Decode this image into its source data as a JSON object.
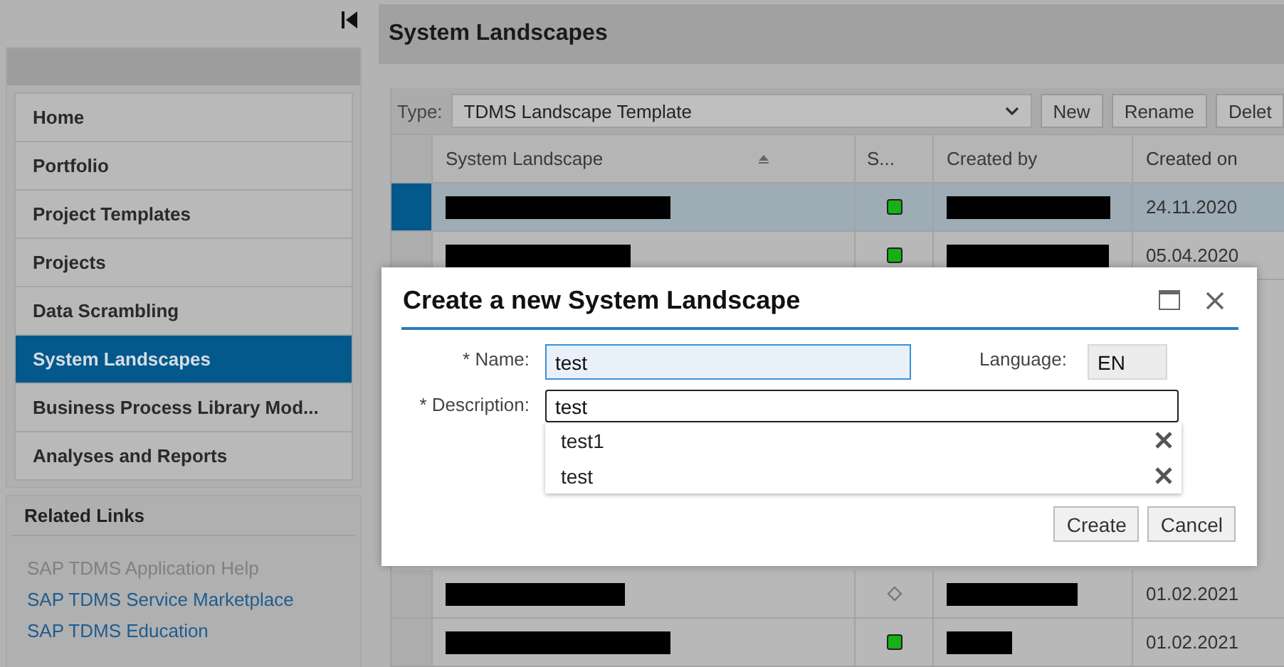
{
  "sidebar": {
    "items": [
      {
        "label": "Home",
        "selected": false
      },
      {
        "label": "Portfolio",
        "selected": false
      },
      {
        "label": "Project Templates",
        "selected": false
      },
      {
        "label": "Projects",
        "selected": false
      },
      {
        "label": "Data Scrambling",
        "selected": false
      },
      {
        "label": "System Landscapes",
        "selected": true
      },
      {
        "label": "Business Process Library Mod...",
        "selected": false
      },
      {
        "label": "Analyses and Reports",
        "selected": false
      }
    ],
    "related_links": {
      "title": "Related Links",
      "links": [
        {
          "label": "SAP TDMS Application Help",
          "disabled": true
        },
        {
          "label": "SAP TDMS Service Marketplace",
          "disabled": false
        },
        {
          "label": "SAP TDMS Education",
          "disabled": false
        }
      ]
    }
  },
  "page_title": "System Landscapes",
  "toolbar": {
    "type_label": "Type:",
    "type_value": "TDMS Landscape Template",
    "buttons": [
      "New",
      "Rename",
      "Delet"
    ]
  },
  "table": {
    "columns": [
      "System Landscape",
      "S...",
      "Created by",
      "Created on"
    ],
    "rows": [
      {
        "selected": true,
        "kind": "ok",
        "created_on": "24.11.2020"
      },
      {
        "selected": false,
        "kind": "ok",
        "created_on": "05.04.2020"
      },
      {
        "selected": false,
        "kind": "inactive",
        "created_on": "01.02.2021"
      },
      {
        "selected": false,
        "kind": "ok",
        "created_on": "01.02.2021"
      }
    ]
  },
  "dialog": {
    "title": "Create a new System Landscape",
    "name_label": "* Name:",
    "name_value": "test",
    "language_label": "Language:",
    "language_value": "EN",
    "description_label": "* Description:",
    "description_value": "test",
    "suggestions": [
      "test1",
      "test"
    ],
    "buttons": [
      "Create",
      "Cancel"
    ]
  }
}
